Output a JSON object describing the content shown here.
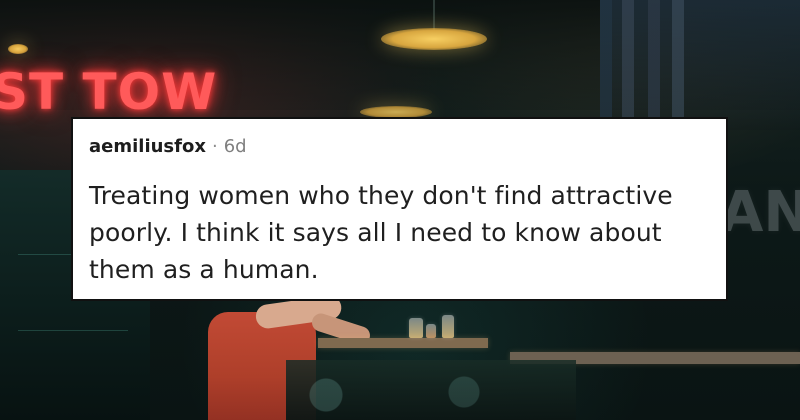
{
  "background": {
    "neon_sign_text": "ST TOW",
    "right_neon_text": "AN"
  },
  "comment": {
    "username": "aemiliusfox",
    "separator": "·",
    "time": "6d",
    "body": "Treating women who they don't find attractive poorly. I think it says all I need to know about them as a human."
  }
}
